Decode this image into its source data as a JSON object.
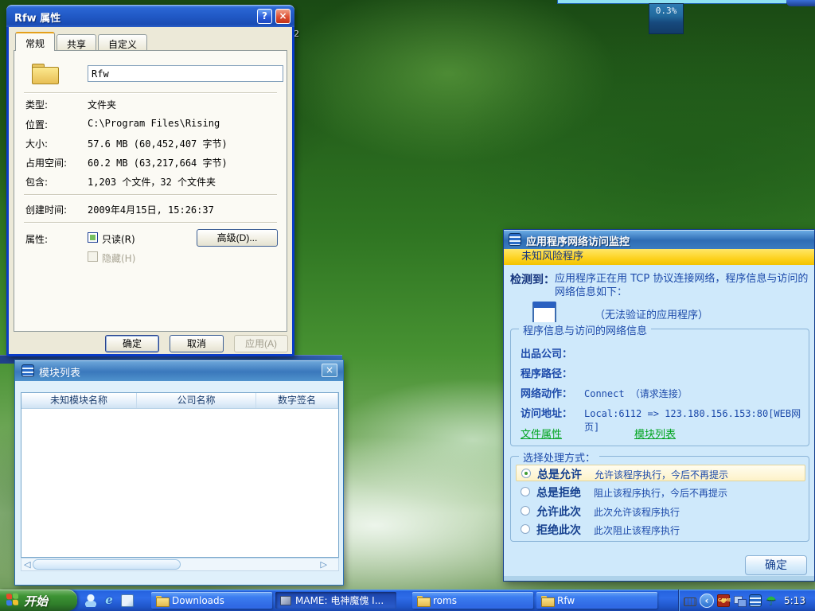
{
  "desktop": {
    "percent_widget": "0.3%",
    "icon_label_fragment": "2"
  },
  "properties_dialog": {
    "title": "Rfw 属性",
    "help_button": "?",
    "close_button": "×",
    "tabs": [
      {
        "label": "常规"
      },
      {
        "label": "共享"
      },
      {
        "label": "自定义"
      }
    ],
    "name_value": "Rfw",
    "rows": [
      {
        "label": "类型:",
        "value": "文件夹"
      },
      {
        "label": "位置:",
        "value": "C:\\Program Files\\Rising"
      },
      {
        "label": "大小:",
        "value": "57.6 MB (60,452,407 字节)"
      },
      {
        "label": "占用空间:",
        "value": "60.2 MB (63,217,664 字节)"
      },
      {
        "label": "包含:",
        "value": "1,203 个文件，32 个文件夹"
      }
    ],
    "created_label": "创建时间:",
    "created_value": "2009年4月15日, 15:26:37",
    "attributes_label": "属性:",
    "readonly_label": "只读(R)",
    "hidden_label": "隐藏(H)",
    "advanced_button": "高级(D)...",
    "ok_button": "确定",
    "cancel_button": "取消",
    "apply_button": "应用(A)"
  },
  "module_window": {
    "title": "模块列表",
    "close_button": "×",
    "columns": [
      {
        "label": "未知模块名称"
      },
      {
        "label": "公司名称"
      },
      {
        "label": "数字签名"
      }
    ],
    "scroll_left": "◁",
    "scroll_right": "▷"
  },
  "monitor_dialog": {
    "title": "应用程序网络访问监控",
    "risk_banner": "未知风险程序",
    "detect_label": "检测到：",
    "detect_text": "应用程序正在用 TCP 协议连接网络，程序信息与访问的网络信息如下：",
    "unverified_text": "（无法验证的应用程序）",
    "info_group_title": "程序信息与访问的网络信息",
    "info_rows": [
      {
        "label": "出品公司：",
        "value": ""
      },
      {
        "label": "程序路径：",
        "value": ""
      },
      {
        "label": "网络动作：",
        "value": "Connect （请求连接）"
      },
      {
        "label": "访问地址：",
        "value": "Local:6112 => 123.180.156.153:80[WEB网页]"
      }
    ],
    "links": [
      {
        "label": "文件属性"
      },
      {
        "label": "模块列表"
      }
    ],
    "choice_group_title": "选择处理方式：",
    "choices": [
      {
        "name": "总是允许",
        "desc": "允许该程序执行，今后不再提示",
        "selected": true
      },
      {
        "name": "总是拒绝",
        "desc": "阻止该程序执行，今后不再提示",
        "selected": false
      },
      {
        "name": "允许此次",
        "desc": "此次允许该程序执行",
        "selected": false
      },
      {
        "name": "拒绝此次",
        "desc": "此次阻止该程序执行",
        "selected": false
      }
    ],
    "ok_button": "确定"
  },
  "taskbar": {
    "start_label": "开始",
    "buttons": [
      {
        "label": "Downloads",
        "pressed": false
      },
      {
        "label": "MAME:  电神魔傀 I...",
        "pressed": true
      },
      {
        "label": "roms",
        "pressed": false
      },
      {
        "label": "Rfw",
        "pressed": false
      }
    ],
    "clock": "5:13"
  },
  "accent_colors": {
    "xp_titlebar_blue": "#2159c6",
    "risk_banner_yellow": "#fdd21e",
    "link_green": "#00a41e",
    "taskbar_blue": "#2e6ce8",
    "start_green": "#3d9434"
  }
}
